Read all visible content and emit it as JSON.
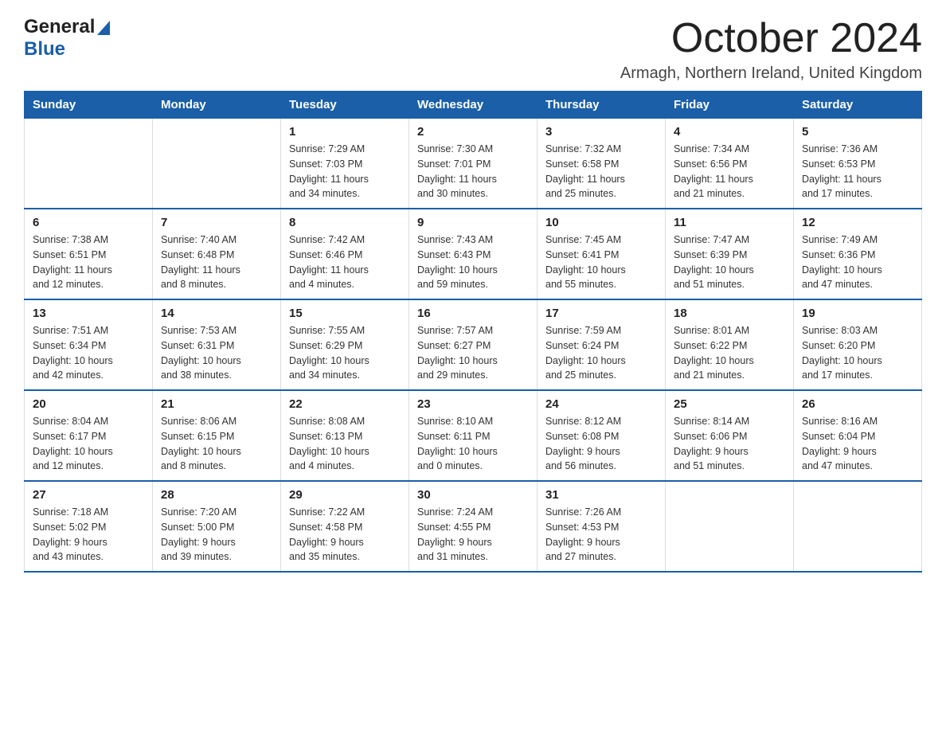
{
  "header": {
    "logo_general": "General",
    "logo_blue": "Blue",
    "month_title": "October 2024",
    "location": "Armagh, Northern Ireland, United Kingdom"
  },
  "weekdays": [
    "Sunday",
    "Monday",
    "Tuesday",
    "Wednesday",
    "Thursday",
    "Friday",
    "Saturday"
  ],
  "weeks": [
    [
      {
        "day": "",
        "info": ""
      },
      {
        "day": "",
        "info": ""
      },
      {
        "day": "1",
        "info": "Sunrise: 7:29 AM\nSunset: 7:03 PM\nDaylight: 11 hours\nand 34 minutes."
      },
      {
        "day": "2",
        "info": "Sunrise: 7:30 AM\nSunset: 7:01 PM\nDaylight: 11 hours\nand 30 minutes."
      },
      {
        "day": "3",
        "info": "Sunrise: 7:32 AM\nSunset: 6:58 PM\nDaylight: 11 hours\nand 25 minutes."
      },
      {
        "day": "4",
        "info": "Sunrise: 7:34 AM\nSunset: 6:56 PM\nDaylight: 11 hours\nand 21 minutes."
      },
      {
        "day": "5",
        "info": "Sunrise: 7:36 AM\nSunset: 6:53 PM\nDaylight: 11 hours\nand 17 minutes."
      }
    ],
    [
      {
        "day": "6",
        "info": "Sunrise: 7:38 AM\nSunset: 6:51 PM\nDaylight: 11 hours\nand 12 minutes."
      },
      {
        "day": "7",
        "info": "Sunrise: 7:40 AM\nSunset: 6:48 PM\nDaylight: 11 hours\nand 8 minutes."
      },
      {
        "day": "8",
        "info": "Sunrise: 7:42 AM\nSunset: 6:46 PM\nDaylight: 11 hours\nand 4 minutes."
      },
      {
        "day": "9",
        "info": "Sunrise: 7:43 AM\nSunset: 6:43 PM\nDaylight: 10 hours\nand 59 minutes."
      },
      {
        "day": "10",
        "info": "Sunrise: 7:45 AM\nSunset: 6:41 PM\nDaylight: 10 hours\nand 55 minutes."
      },
      {
        "day": "11",
        "info": "Sunrise: 7:47 AM\nSunset: 6:39 PM\nDaylight: 10 hours\nand 51 minutes."
      },
      {
        "day": "12",
        "info": "Sunrise: 7:49 AM\nSunset: 6:36 PM\nDaylight: 10 hours\nand 47 minutes."
      }
    ],
    [
      {
        "day": "13",
        "info": "Sunrise: 7:51 AM\nSunset: 6:34 PM\nDaylight: 10 hours\nand 42 minutes."
      },
      {
        "day": "14",
        "info": "Sunrise: 7:53 AM\nSunset: 6:31 PM\nDaylight: 10 hours\nand 38 minutes."
      },
      {
        "day": "15",
        "info": "Sunrise: 7:55 AM\nSunset: 6:29 PM\nDaylight: 10 hours\nand 34 minutes."
      },
      {
        "day": "16",
        "info": "Sunrise: 7:57 AM\nSunset: 6:27 PM\nDaylight: 10 hours\nand 29 minutes."
      },
      {
        "day": "17",
        "info": "Sunrise: 7:59 AM\nSunset: 6:24 PM\nDaylight: 10 hours\nand 25 minutes."
      },
      {
        "day": "18",
        "info": "Sunrise: 8:01 AM\nSunset: 6:22 PM\nDaylight: 10 hours\nand 21 minutes."
      },
      {
        "day": "19",
        "info": "Sunrise: 8:03 AM\nSunset: 6:20 PM\nDaylight: 10 hours\nand 17 minutes."
      }
    ],
    [
      {
        "day": "20",
        "info": "Sunrise: 8:04 AM\nSunset: 6:17 PM\nDaylight: 10 hours\nand 12 minutes."
      },
      {
        "day": "21",
        "info": "Sunrise: 8:06 AM\nSunset: 6:15 PM\nDaylight: 10 hours\nand 8 minutes."
      },
      {
        "day": "22",
        "info": "Sunrise: 8:08 AM\nSunset: 6:13 PM\nDaylight: 10 hours\nand 4 minutes."
      },
      {
        "day": "23",
        "info": "Sunrise: 8:10 AM\nSunset: 6:11 PM\nDaylight: 10 hours\nand 0 minutes."
      },
      {
        "day": "24",
        "info": "Sunrise: 8:12 AM\nSunset: 6:08 PM\nDaylight: 9 hours\nand 56 minutes."
      },
      {
        "day": "25",
        "info": "Sunrise: 8:14 AM\nSunset: 6:06 PM\nDaylight: 9 hours\nand 51 minutes."
      },
      {
        "day": "26",
        "info": "Sunrise: 8:16 AM\nSunset: 6:04 PM\nDaylight: 9 hours\nand 47 minutes."
      }
    ],
    [
      {
        "day": "27",
        "info": "Sunrise: 7:18 AM\nSunset: 5:02 PM\nDaylight: 9 hours\nand 43 minutes."
      },
      {
        "day": "28",
        "info": "Sunrise: 7:20 AM\nSunset: 5:00 PM\nDaylight: 9 hours\nand 39 minutes."
      },
      {
        "day": "29",
        "info": "Sunrise: 7:22 AM\nSunset: 4:58 PM\nDaylight: 9 hours\nand 35 minutes."
      },
      {
        "day": "30",
        "info": "Sunrise: 7:24 AM\nSunset: 4:55 PM\nDaylight: 9 hours\nand 31 minutes."
      },
      {
        "day": "31",
        "info": "Sunrise: 7:26 AM\nSunset: 4:53 PM\nDaylight: 9 hours\nand 27 minutes."
      },
      {
        "day": "",
        "info": ""
      },
      {
        "day": "",
        "info": ""
      }
    ]
  ]
}
